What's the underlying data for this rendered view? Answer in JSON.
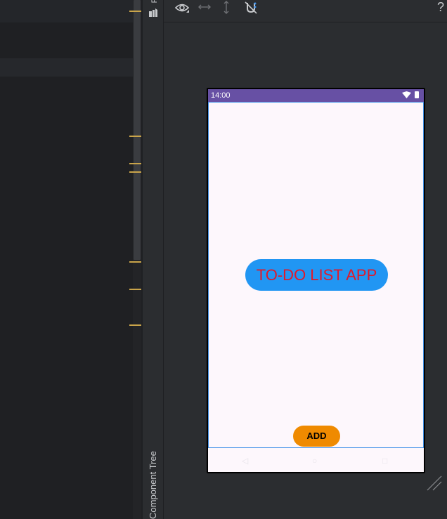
{
  "editor": {
    "markers_count_note": ""
  },
  "toolstrip": {
    "palette_label": "P",
    "component_tree_label": "Component Tree"
  },
  "toolbar": {
    "eye_icon": "eye-icon",
    "horizontal_icon": "horizontal-arrows-icon",
    "vertical_icon": "vertical-arrows-icon",
    "magnet_icon": "magnet-off-icon",
    "help_label": "?"
  },
  "device": {
    "status_time": "14:00",
    "title_button_label": "TO-DO LIST APP",
    "add_button_label": "ADD",
    "nav_back": "◁",
    "nav_home": "○",
    "nav_recents": "□"
  },
  "colors": {
    "status_bar": "#6750a4",
    "title_button_bg": "#2196f3",
    "title_button_text": "#e0192a",
    "add_button_bg": "#ef8a00",
    "marker": "#c9a44a",
    "selection": "#3d8fe8"
  }
}
